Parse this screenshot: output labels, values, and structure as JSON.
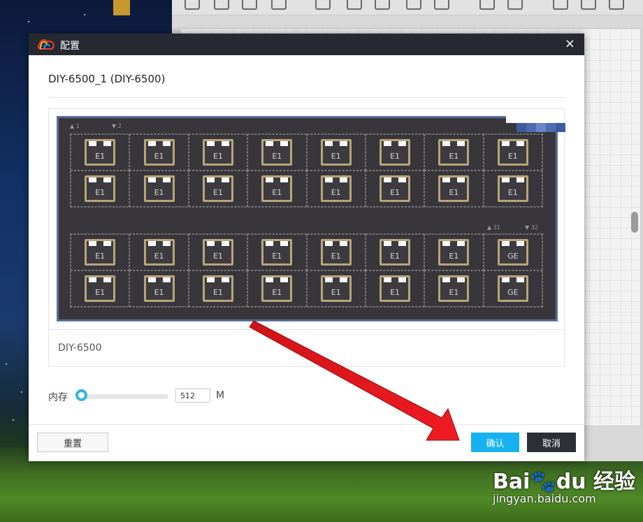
{
  "dialog": {
    "title": "配置",
    "close": "×",
    "device_title": "DIY-6500_1 (DIY-6500)",
    "model": "DIY-6500",
    "memory": {
      "label": "内存",
      "value": "512",
      "unit": "M",
      "slider_fraction": 0
    },
    "buttons": {
      "reset": "重置",
      "ok": "确认",
      "cancel": "取消"
    }
  },
  "board": {
    "port_markers": [
      "1",
      "2",
      "31",
      "32"
    ],
    "top_rows": [
      [
        "E1",
        "E1",
        "E1",
        "E1",
        "E1",
        "E1",
        "E1",
        "E1"
      ],
      [
        "E1",
        "E1",
        "E1",
        "E1",
        "E1",
        "E1",
        "E1",
        "E1"
      ]
    ],
    "bottom_rows": [
      [
        "E1",
        "E1",
        "E1",
        "E1",
        "E1",
        "E1",
        "E1",
        "GE"
      ],
      [
        "E1",
        "E1",
        "E1",
        "E1",
        "E1",
        "E1",
        "E1",
        "GE"
      ]
    ],
    "strip_colors": [
      "#3c5aa0",
      "#4e6cb4",
      "#6a86c8",
      "#4e6cb4",
      "#3c5aa0"
    ]
  },
  "watermark": {
    "brand": "Bai du 经验",
    "url": "jingyan.baidu.com"
  },
  "colors": {
    "accent": "#16b1f0",
    "arrow": "#e8141a",
    "board": "#38363b",
    "port_border": "#b8a57a"
  }
}
